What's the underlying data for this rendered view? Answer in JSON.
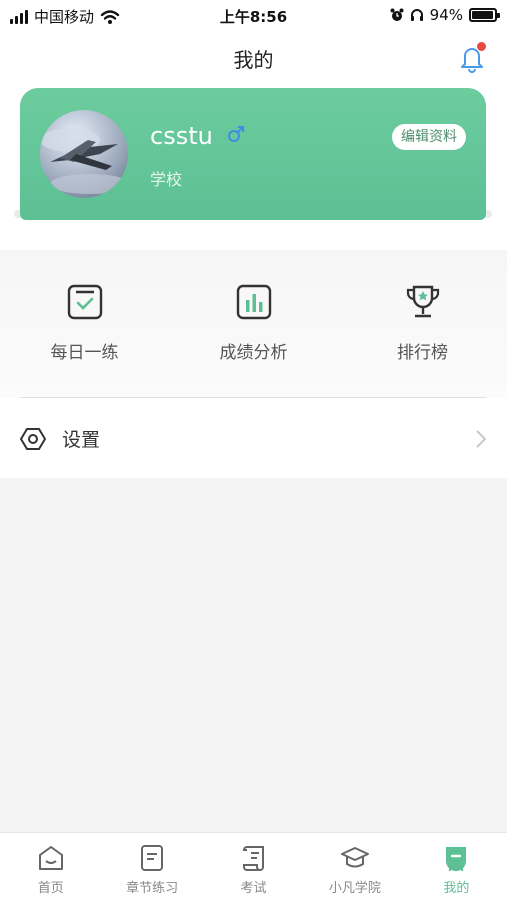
{
  "status_bar": {
    "carrier": "中国移动",
    "time": "上午8:56",
    "battery_text": "94%",
    "battery_level": 0.94
  },
  "header": {
    "title": "我的",
    "has_notification_dot": true
  },
  "profile": {
    "username": "csstu",
    "gender_icon": "male-icon",
    "school": "学校",
    "edit_button": "编辑资料",
    "card_color": "#5cc094"
  },
  "quick_actions": [
    {
      "label": "每日一练",
      "icon": "daily-practice-icon"
    },
    {
      "label": "成绩分析",
      "icon": "bar-chart-icon"
    },
    {
      "label": "排行榜",
      "icon": "trophy-icon"
    }
  ],
  "settings": {
    "label": "设置",
    "icon": "hexagon-settings-icon"
  },
  "tabbar": {
    "items": [
      {
        "label": "首页",
        "icon": "home-icon"
      },
      {
        "label": "章节练习",
        "icon": "chapter-icon"
      },
      {
        "label": "考试",
        "icon": "exam-scroll-icon"
      },
      {
        "label": "小凡学院",
        "icon": "graduation-cap-icon"
      },
      {
        "label": "我的",
        "icon": "profile-icon",
        "active": true
      }
    ],
    "active_color": "#5cc094"
  }
}
